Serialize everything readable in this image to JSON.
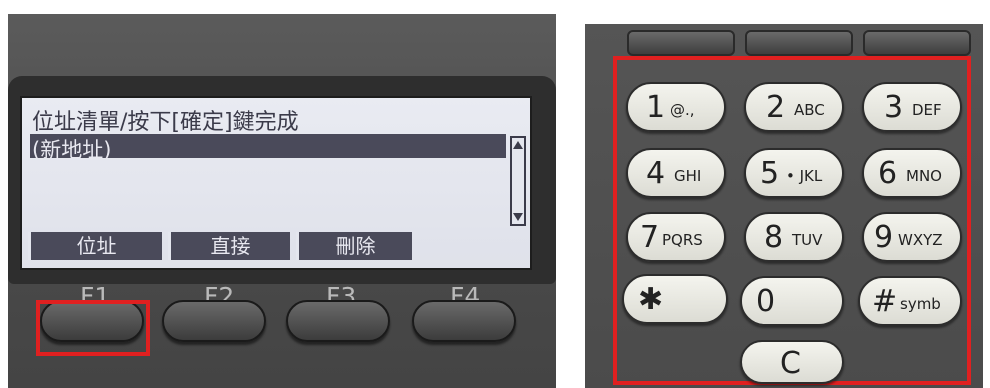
{
  "lcd": {
    "title": "位址清單/按下[確定]鍵完成",
    "selected_item": "(新地址)",
    "softkeys": [
      "位址",
      "直接",
      "刪除"
    ]
  },
  "function_keys": [
    "F1",
    "F2",
    "F3",
    "F4"
  ],
  "keypad": {
    "keys": [
      {
        "main": "1",
        "sub": "@.,"
      },
      {
        "main": "2",
        "sub": "ABC"
      },
      {
        "main": "3",
        "sub": "DEF"
      },
      {
        "main": "4",
        "sub": "GHI"
      },
      {
        "main": "5",
        "sub": "• JKL"
      },
      {
        "main": "6",
        "sub": "MNO"
      },
      {
        "main": "7",
        "sub": "PQRS"
      },
      {
        "main": "8",
        "sub": "TUV"
      },
      {
        "main": "9",
        "sub": "WXYZ"
      },
      {
        "main": "✱",
        "sub": ""
      },
      {
        "main": "0",
        "sub": ""
      },
      {
        "main": "#",
        "sub": "symb"
      },
      {
        "main": "C",
        "sub": ""
      }
    ]
  },
  "colors": {
    "highlight": "#e02020",
    "lcd_background": "#e4e6ee",
    "lcd_text": "#3b3b4a"
  }
}
